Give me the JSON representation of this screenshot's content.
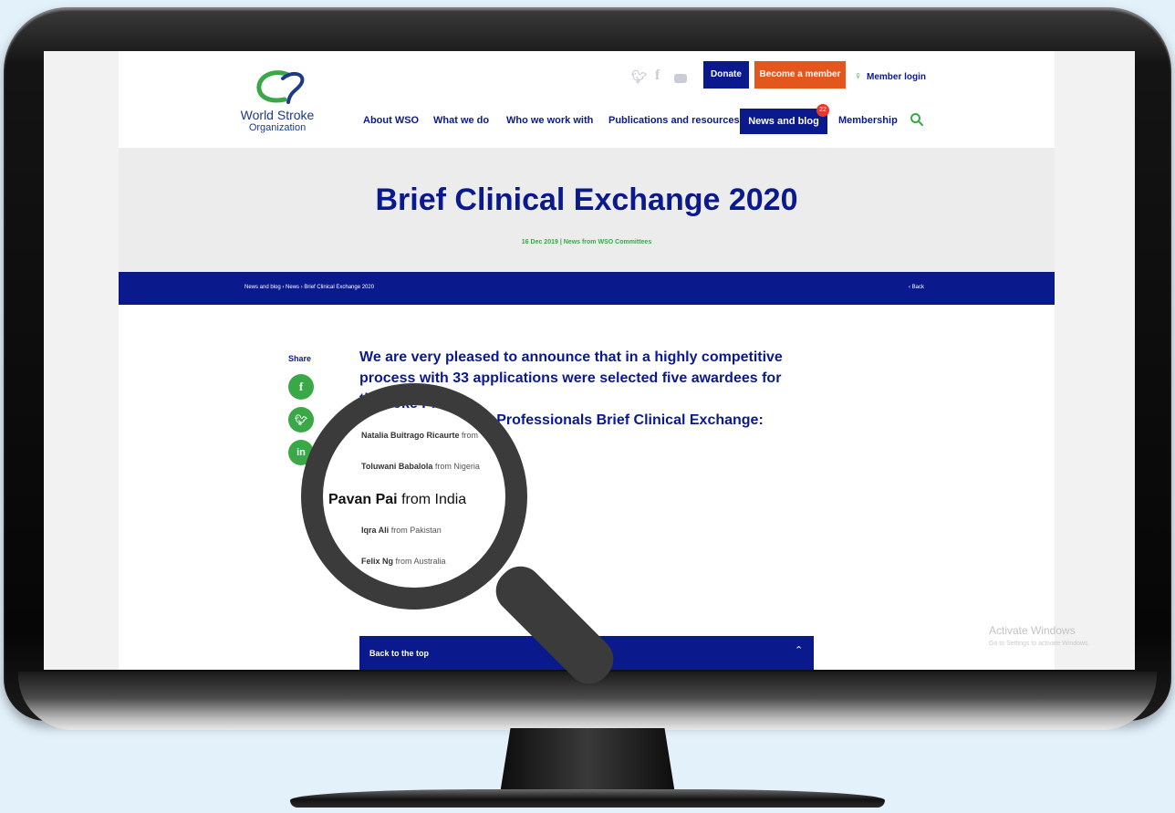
{
  "header": {
    "logo": {
      "title": "World Stroke",
      "subtitle": "Organization"
    },
    "social": [
      "twitter-icon",
      "facebook-icon",
      "youtube-icon"
    ],
    "donate_label": "Donate",
    "become_member_label": "Become a member",
    "member_login_label": "Member login",
    "nav": [
      {
        "label": "About WSO"
      },
      {
        "label": "What we do"
      },
      {
        "label": "Who we work with"
      },
      {
        "label": "Publications and resources"
      },
      {
        "label": "News and blog",
        "badge": "22"
      },
      {
        "label": "Membership"
      }
    ]
  },
  "hero": {
    "title": "Brief Clinical Exchange 2020",
    "date": "16 Dec 2019",
    "separator": "|",
    "category": "News from WSO Committees"
  },
  "breadcrumb": {
    "path": "News and blog › News › Brief Clinical Exchange 2020",
    "back": "‹ Back"
  },
  "share": {
    "label": "Share"
  },
  "article": {
    "lead_line1": "We are very pleased to announce that in a highly competitive",
    "lead_line2": "process with 33 applications were selected five awardees for the",
    "lead_line3": "Stroke Professionals Brief Clinical Exchange:",
    "awardees": [
      {
        "name": "Natalia Buitrago Ricaurte",
        "from": "from"
      },
      {
        "name": "Toluwani Babalola",
        "from": "from Nigeria"
      },
      {
        "name": "Pavan Pai",
        "from": "from India"
      },
      {
        "name": "Iqra Ali",
        "from": "from Pakistan"
      },
      {
        "name": "Felix Ng",
        "from": "from Australia"
      }
    ]
  },
  "back_to_top": {
    "label": "Back to the top"
  },
  "watermark": {
    "title": "Activate Windows",
    "subtitle": "Go to Settings to activate Windows."
  }
}
